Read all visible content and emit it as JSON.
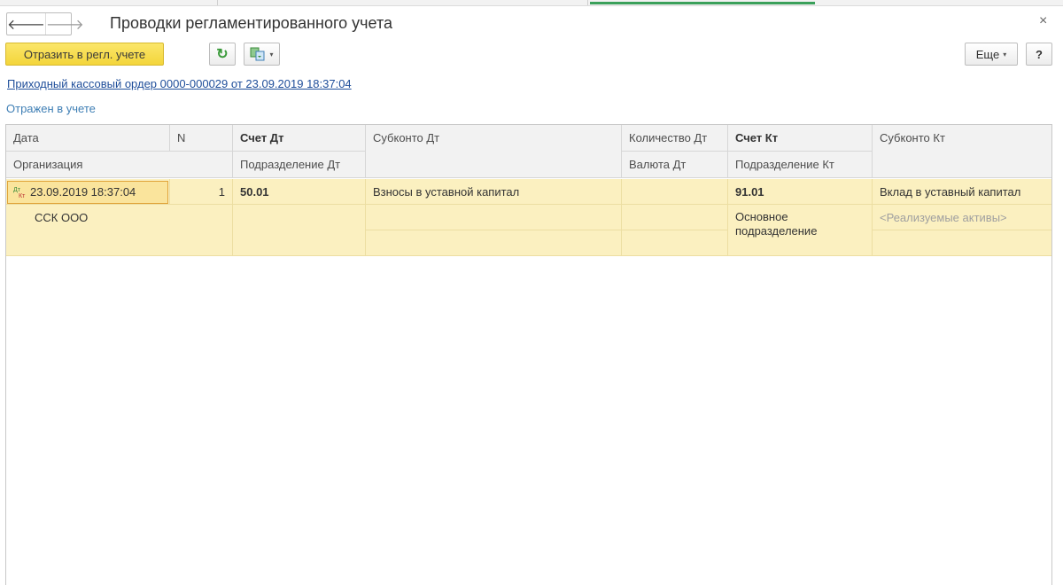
{
  "window": {
    "title": "Проводки регламентированного учета",
    "close_glyph": "×",
    "nav": {
      "back_glyph": "🡐",
      "forward_glyph": "🡒"
    }
  },
  "toolbar": {
    "primary_label": "Отразить в регл. учете",
    "refresh_glyph": "↻",
    "more_label": "Еще",
    "dropdown_glyph": "▾",
    "help_label": "?"
  },
  "document": {
    "link": "Приходный кассовый ордер 0000-000029 от 23.09.2019 18:37:04",
    "status": "Отражен в учете"
  },
  "table": {
    "headers": {
      "date": "Дата",
      "n": "N",
      "account_dt": "Счет Дт",
      "subkonto_dt": "Субконто Дт",
      "qty_dt": "Количество Дт",
      "account_kt": "Счет Кт",
      "subkonto_kt": "Субконто Кт",
      "organization": "Организация",
      "division_dt": "Подразделение Дт",
      "currency_dt": "Валюта Дт",
      "division_kt": "Подразделение Кт"
    },
    "rows": [
      {
        "badge_dt": "Дт",
        "badge_kt": "Кт",
        "date": "23.09.2019 18:37:04",
        "n": "1",
        "account_dt": "50.01",
        "subkonto_dt_1": "Взносы в уставной капитал",
        "account_kt": "91.01",
        "subkonto_kt_1": "Вклад в уставный капитал",
        "organization": "ССК ООО",
        "division_kt": "Основное подразделение",
        "subkonto_kt_2": "<Реализуемые активы>"
      }
    ]
  },
  "colors": {
    "primary_button": "#f3d53a",
    "row_highlight": "#fbf0c0",
    "link": "#1f4e9a",
    "status": "#3f7fb5"
  }
}
